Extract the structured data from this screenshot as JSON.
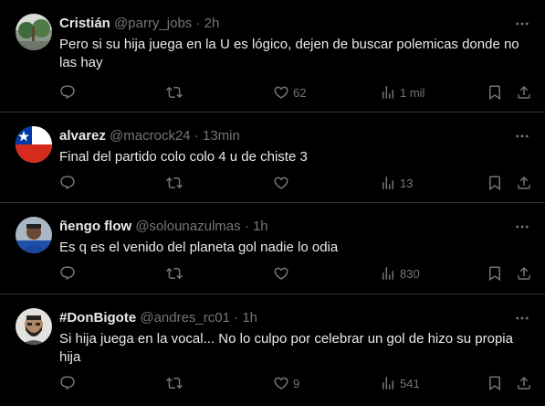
{
  "tweets": [
    {
      "name": "Cristián",
      "handle": "@parry_jobs",
      "time": "2h",
      "text": "Pero si su hija juega en la U es lógico, dejen de buscar polemicas donde no las hay",
      "likes": "62",
      "views": "1 mil"
    },
    {
      "name": "alvarez",
      "handle": "@macrock24",
      "time": "13min",
      "text": "Final del partido colo colo 4 u de chiste 3",
      "likes": "",
      "views": "13"
    },
    {
      "name": "ñengo flow",
      "handle": "@solounazulmas",
      "time": "1h",
      "text": "Es q es el venido del planeta gol nadie lo odia",
      "likes": "",
      "views": "830"
    },
    {
      "name": "#DonBigote",
      "handle": "@andres_rc01",
      "time": "1h",
      "text": "Si hija juega en la vocal... No lo culpo por celebrar un gol de hizo su propia hija",
      "likes": "9",
      "views": "541"
    }
  ],
  "icons": {
    "reply": "reply-icon",
    "retweet": "retweet-icon",
    "like": "like-icon",
    "views": "views-icon",
    "bookmark": "bookmark-icon",
    "share": "share-icon",
    "more": "more-icon"
  },
  "colors": {
    "background": "#000000",
    "text": "#e7e9ea",
    "muted": "#71767b",
    "divider": "#2f3336"
  }
}
